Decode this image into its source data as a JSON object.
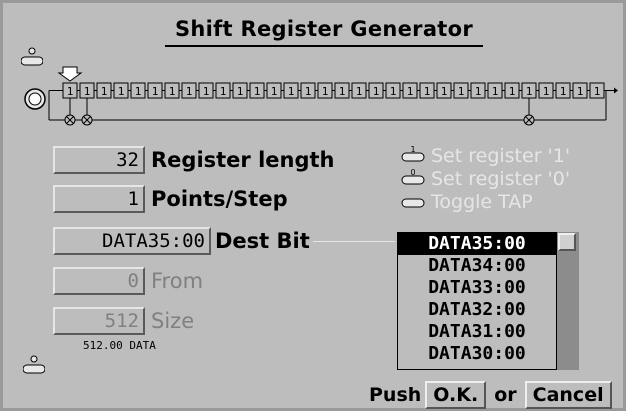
{
  "window": {
    "title": "Shift Register Generator"
  },
  "register": {
    "bit_value": "1",
    "bit_count": 32,
    "tap_bits": [
      0,
      1,
      27
    ]
  },
  "fields": {
    "register_length": {
      "value": "32",
      "label": "Register length"
    },
    "points_per_step": {
      "value": "1",
      "label": "Points/Step"
    },
    "dest_bit": {
      "value": "DATA35:00",
      "label": "Dest Bit"
    },
    "from": {
      "value": "0",
      "label": "From"
    },
    "size": {
      "value": "512",
      "label": "Size",
      "sub": "512.00 DATA"
    }
  },
  "hints": {
    "set_one": "Set register '1'",
    "set_zero": "Set register '0'",
    "toggle_tap": "Toggle TAP"
  },
  "dest_list": {
    "items": [
      "DATA35:00",
      "DATA34:00",
      "DATA33:00",
      "DATA32:00",
      "DATA31:00",
      "DATA30:00"
    ],
    "selected_index": 0
  },
  "footer": {
    "push": "Push",
    "ok": "O.K.",
    "or": "or",
    "cancel": "Cancel"
  },
  "colors": {
    "panel": "#bdbdbd",
    "border": "#9a9a9a",
    "disabled": "#808080",
    "hint": "#e6e6e6"
  }
}
